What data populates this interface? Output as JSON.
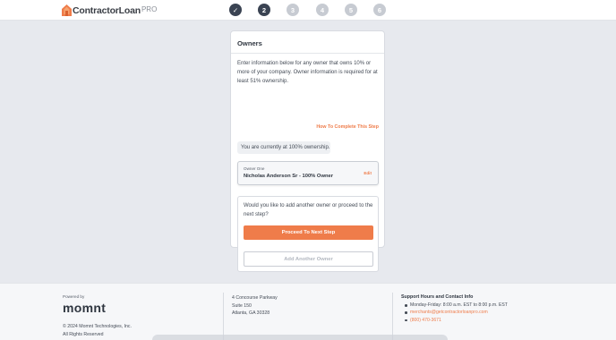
{
  "header": {
    "logo_text": "ContractorLoan",
    "logo_pro": "PRO",
    "steps": [
      {
        "label": "✓",
        "state": "done"
      },
      {
        "label": "2",
        "state": "active"
      },
      {
        "label": "3",
        "state": "pending"
      },
      {
        "label": "4",
        "state": "pending"
      },
      {
        "label": "5",
        "state": "pending"
      },
      {
        "label": "6",
        "state": "pending"
      }
    ]
  },
  "card": {
    "title": "Owners",
    "intro": "Enter information below for any owner that owns 10% or more of your company. Owner information is required for at least 51% ownership.",
    "how_to_link": "How To Complete This Step",
    "ownership_status": "You are currently at 100% ownership.",
    "owner": {
      "label": "Owner One",
      "name": "Nicholas Anderson Sr - 100% Owner",
      "edit_label": "Edit"
    },
    "next": {
      "question": "Would you like to add another owner or proceed to the next step?",
      "proceed_label": "Proceed To Next Step",
      "add_owner_label": "Add Another Owner"
    }
  },
  "footer": {
    "powered_by": "Powered by",
    "brand": "momnt",
    "copyright_line1": "© 2024 Momnt Technologies, Inc.",
    "copyright_line2": "All Rights Reserved",
    "address_line1": "4 Concourse Parkway",
    "address_line2": "Suite 150",
    "address_line3": "Atlanta, GA 30328",
    "support_title": "Support Hours and Contact Info",
    "support_hours": "Monday-Friday: 8:00 a.m. EST to 8:00 p.m. EST",
    "support_email": "merchants@getcontractorloanpro.com",
    "support_phone": "(800) 470-3671"
  },
  "colors": {
    "accent": "#ef7c4a",
    "dark": "#3a4352",
    "pending": "#c7cbd2",
    "background": "#e7e9ee"
  }
}
